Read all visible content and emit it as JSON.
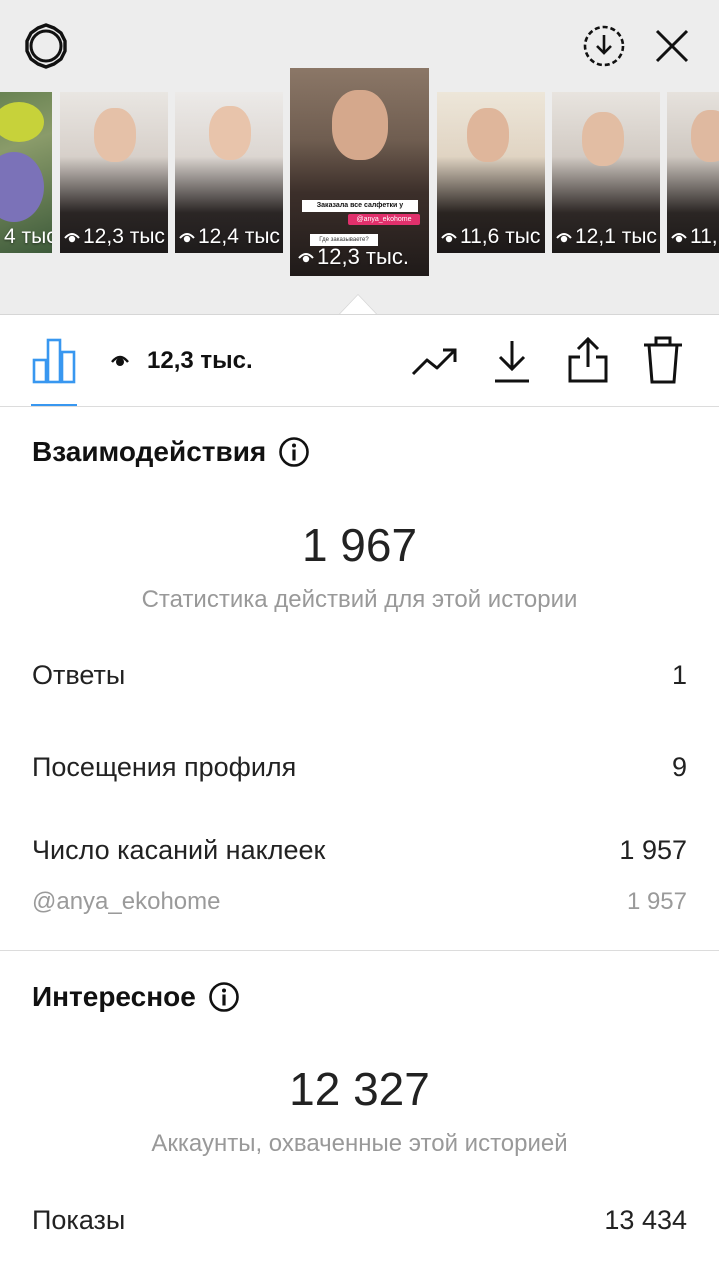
{
  "thumbnails": [
    {
      "views": "4 тыс",
      "bg": "#6e7f55"
    },
    {
      "views": "12,3 тыс",
      "bg": "#cfc9c4"
    },
    {
      "views": "12,4 тыс",
      "bg": "#d8d3cf"
    },
    {
      "views": "12,3 тыс.",
      "bg": "#6c5a4c",
      "active": true
    },
    {
      "views": "11,6 тыс",
      "bg": "#d9d0c3"
    },
    {
      "views": "12,1 тыс",
      "bg": "#c7c1bb"
    },
    {
      "views": "11,",
      "bg": "#bfbab4"
    }
  ],
  "story_overlay": {
    "caption": "Заказала все салфетки у",
    "mention": "@anya_ekohome",
    "question": "Где заказываете?"
  },
  "toolbar": {
    "views": "12,3 тыс."
  },
  "interactions": {
    "title": "Взаимодействия",
    "total": "1 967",
    "subtitle": "Статистика действий для этой истории",
    "rows": [
      {
        "label": "Ответы",
        "value": "1"
      },
      {
        "label": "Посещения профиля",
        "value": "9"
      },
      {
        "label": "Число касаний наклеек",
        "value": "1 957"
      }
    ],
    "sub_row": {
      "label": "@anya_ekohome",
      "value": "1 957"
    }
  },
  "discovery": {
    "title": "Интересное",
    "total": "12 327",
    "subtitle": "Аккаунты, охваченные этой историей",
    "rows": [
      {
        "label": "Показы",
        "value": "13 434"
      }
    ]
  },
  "colors": {
    "accent": "#3897f0",
    "header_bg": "#ededed"
  }
}
